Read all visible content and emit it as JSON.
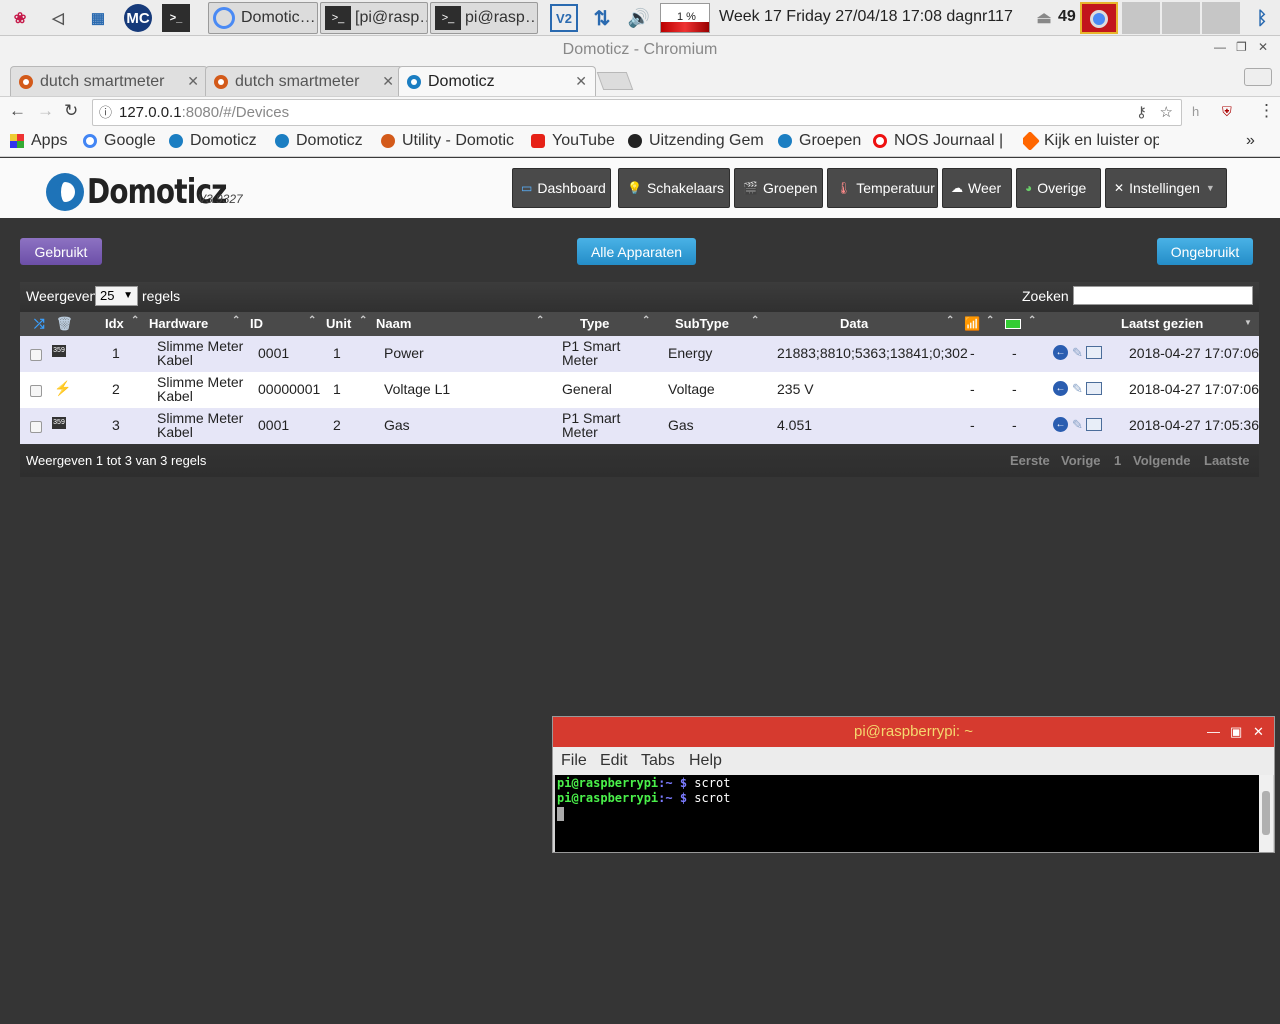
{
  "taskbar": {
    "tasks": [
      "Domotic…",
      "[pi@rasp…",
      "pi@rasp…"
    ],
    "cpu": "1 %",
    "clock": "Week 17 Friday 27/04/18 17:08 dagnr117",
    "updates": "49"
  },
  "window": {
    "title": "Domoticz - Chromium"
  },
  "browser": {
    "tabs": [
      {
        "label": "dutch smartmeter"
      },
      {
        "label": "dutch smartmeter"
      },
      {
        "label": "Domoticz"
      }
    ],
    "url_host": "127.0.0.1",
    "url_rest": ":8080/#/Devices",
    "bookmarks": [
      "Apps",
      "Google",
      "Domoticz",
      "Domoticz",
      "Utility - Domotic",
      "YouTube",
      "Uitzending Gem",
      "Groepen",
      "NOS Journaal |",
      "Kijk en luister op"
    ],
    "bookmarks_more": "»"
  },
  "domoticz": {
    "logo": "Domoticz",
    "version": "V3.9327",
    "nav": [
      "Dashboard",
      "Schakelaars",
      "Groepen",
      "Temperatuur",
      "Weer",
      "Overige",
      "Instellingen"
    ]
  },
  "devices": {
    "btn_used": "Gebruikt",
    "btn_all": "Alle Apparaten",
    "btn_unused": "Ongebruikt",
    "show_label": "Weergeven",
    "show_value": "25",
    "rows_label": "regels",
    "search_label": "Zoeken :",
    "search_value": "",
    "columns": [
      "Idx",
      "Hardware",
      "ID",
      "Unit",
      "Naam",
      "Type",
      "SubType",
      "Data",
      "Laatst gezien"
    ],
    "rows": [
      {
        "icon": "359",
        "idx": "1",
        "hw1": "Slimme Meter",
        "hw2": "Kabel",
        "id": "0001",
        "unit": "1",
        "name": "Power",
        "type1": "P1 Smart",
        "type2": "Meter",
        "subtype": "Energy",
        "data": "21883;8810;5363;13841;0;302",
        "sig": "-",
        "bat": "-",
        "seen": "2018-04-27 17:07:06"
      },
      {
        "icon": "",
        "idx": "2",
        "hw1": "Slimme Meter",
        "hw2": "Kabel",
        "id": "00000001",
        "unit": "1",
        "name": "Voltage L1",
        "type1": "General",
        "type2": "",
        "subtype": "Voltage",
        "data": "235 V",
        "sig": "-",
        "bat": "-",
        "seen": "2018-04-27 17:07:06"
      },
      {
        "icon": "359",
        "idx": "3",
        "hw1": "Slimme Meter",
        "hw2": "Kabel",
        "id": "0001",
        "unit": "2",
        "name": "Gas",
        "type1": "P1 Smart",
        "type2": "Meter",
        "subtype": "Gas",
        "data": "4.051",
        "sig": "-",
        "bat": "-",
        "seen": "2018-04-27 17:05:36"
      }
    ],
    "footer": "Weergeven 1 tot 3 van 3 regels",
    "pager": [
      "Eerste",
      "Vorige",
      "1",
      "Volgende",
      "Laatste"
    ]
  },
  "terminal": {
    "title": "pi@raspberrypi: ~",
    "menu": [
      "File",
      "Edit",
      "Tabs",
      "Help"
    ],
    "prompt_user": "pi@raspberrypi",
    "prompt_path": ":~ $",
    "lines": [
      "scrot",
      "scrot"
    ]
  },
  "colors": {
    "purple": "#7b5cb0",
    "blue": "#2f9bd6",
    "row_alt": "#e6e6f7",
    "row": "#ffffff",
    "term_title": "#d63a2f"
  }
}
